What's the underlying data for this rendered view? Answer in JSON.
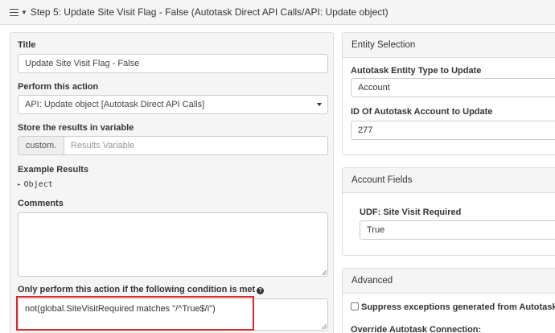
{
  "header": {
    "title": "Step 5: Update Site Visit Flag - False (Autotask Direct API Calls/API: Update object)"
  },
  "left": {
    "title_label": "Title",
    "title_value": "Update Site Visit Flag - False",
    "action_label": "Perform this action",
    "action_value": "API: Update object [Autotask Direct API Calls]",
    "store_label": "Store the results in variable",
    "store_prefix": "custom.",
    "store_placeholder": "Results Variable",
    "example_label": "Example Results",
    "example_value": "Object",
    "comments_label": "Comments",
    "comments_value": "",
    "condition_label": "Only perform this action if the following condition is met",
    "condition_value": "not(global.SiteVisitRequired matches \"/^True$/i\")"
  },
  "entity": {
    "heading": "Entity Selection",
    "type_label": "Autotask Entity Type to Update",
    "type_value": "Account",
    "id_label": "ID Of Autotask Account to Update",
    "id_value": "277"
  },
  "fields": {
    "heading": "Account Fields",
    "udf_label": "UDF: Site Visit Required",
    "udf_value": "True"
  },
  "advanced": {
    "heading": "Advanced",
    "suppress_label": "Suppress exceptions generated from Autotask API",
    "override_label": "Override Autotask Connection:"
  },
  "colors": {
    "highlight": "#d9282f",
    "panel_bg": "#f5f5f5",
    "border": "#dddddd"
  },
  "icons": [
    "hamburger-icon",
    "caret-down-icon",
    "question-circle-icon",
    "chevron-down-icon",
    "triangle-right-icon"
  ]
}
